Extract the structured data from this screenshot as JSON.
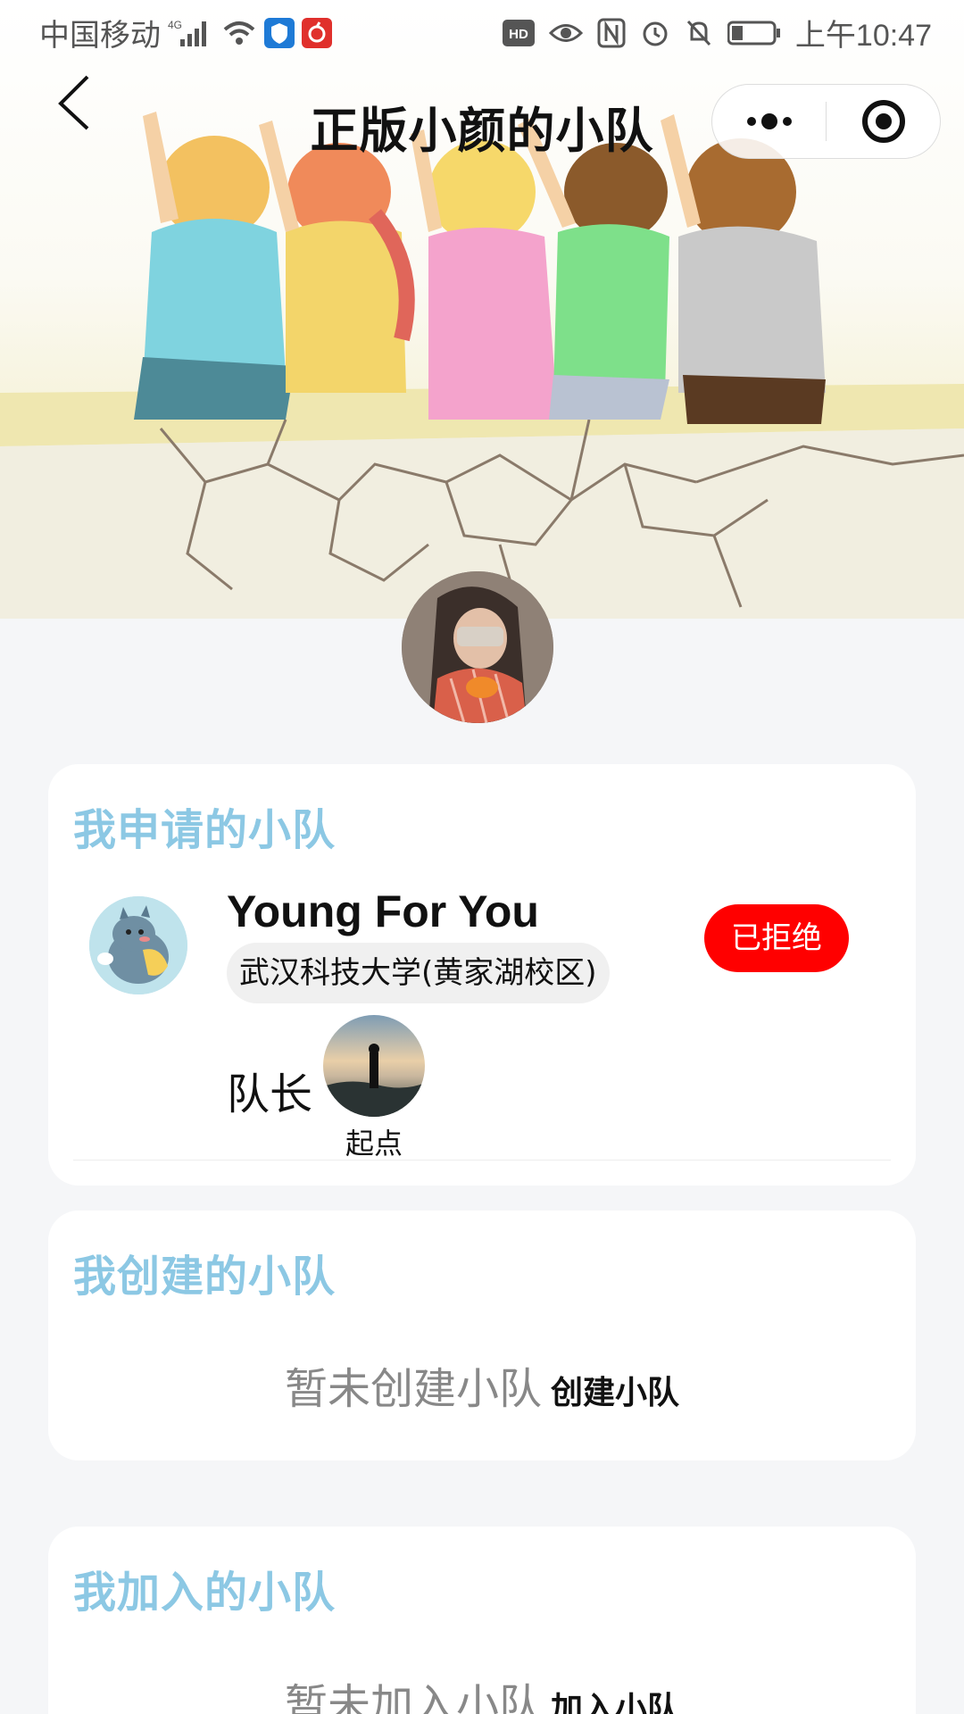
{
  "status_bar": {
    "carrier": "中国移动",
    "network": "4G",
    "time": "上午10:47",
    "hd_badge": "HD",
    "icons": [
      "signal-icon",
      "wifi-icon",
      "shield-app-icon",
      "netease-music-icon",
      "eye-comfort-icon",
      "nfc-icon",
      "alarm-icon",
      "mute-icon",
      "battery-icon"
    ]
  },
  "nav": {
    "title": "正版小颜的小队",
    "back_icon": "chevron-left-icon",
    "more_icon": "more-dots-icon",
    "close_icon": "target-close-icon"
  },
  "applied_section": {
    "title": "我申请的小队",
    "team": {
      "name": "Young For You",
      "school": "武汉科技大学(黄家湖校区)",
      "status": "已拒绝",
      "captain_label": "队长",
      "captain_name": "起点"
    }
  },
  "created_section": {
    "title": "我创建的小队",
    "empty_text": "暂未创建小队",
    "action_label": "创建小队"
  },
  "joined_section": {
    "title": "我加入的小队",
    "empty_text": "暂未加入小队",
    "action_label": "加入小队"
  },
  "colors": {
    "section_title": "#8cc8e4",
    "status_rejected": "#ff0000",
    "page_background": "#f5f6f8"
  }
}
